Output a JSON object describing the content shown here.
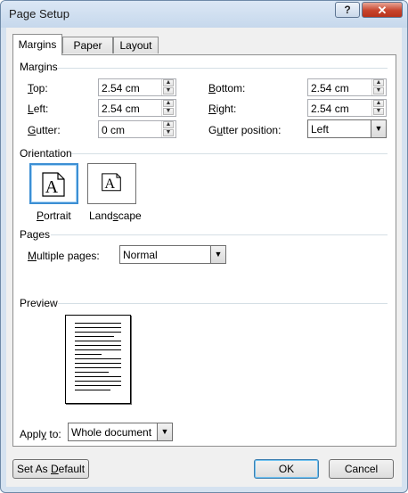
{
  "window": {
    "title": "Page Setup",
    "help_label": "?",
    "close_label": "✕"
  },
  "tabs": [
    {
      "label": "Margins"
    },
    {
      "label": "Paper"
    },
    {
      "label": "Layout"
    }
  ],
  "margins": {
    "group_label": "Margins",
    "top": {
      "label": "Top:",
      "value": "2.54 cm"
    },
    "bottom": {
      "label": "Bottom:",
      "value": "2.54 cm"
    },
    "left": {
      "label": "Left:",
      "value": "2.54 cm"
    },
    "right": {
      "label": "Right:",
      "value": "2.54 cm"
    },
    "gutter": {
      "label": "Gutter:",
      "value": "0 cm"
    },
    "gutter_position": {
      "label": "Gutter position:",
      "value": "Left"
    }
  },
  "orientation": {
    "group_label": "Orientation",
    "portrait_label": "Portrait",
    "landscape_label": "Landscape",
    "icon_letter": "A",
    "selected": "Portrait"
  },
  "pages": {
    "group_label": "Pages",
    "multiple_pages_label": "Multiple pages:",
    "multiple_pages_value": "Normal"
  },
  "preview": {
    "group_label": "Preview"
  },
  "apply_to": {
    "label": "Apply to:",
    "value": "Whole document"
  },
  "buttons": {
    "set_default": "Set As Default",
    "ok": "OK",
    "cancel": "Cancel"
  },
  "colors": {
    "accent": "#3c8fd4",
    "close": "#c7442c"
  },
  "icons": {
    "spin_up": "▲",
    "spin_down": "▼",
    "dropdown": "▼"
  }
}
